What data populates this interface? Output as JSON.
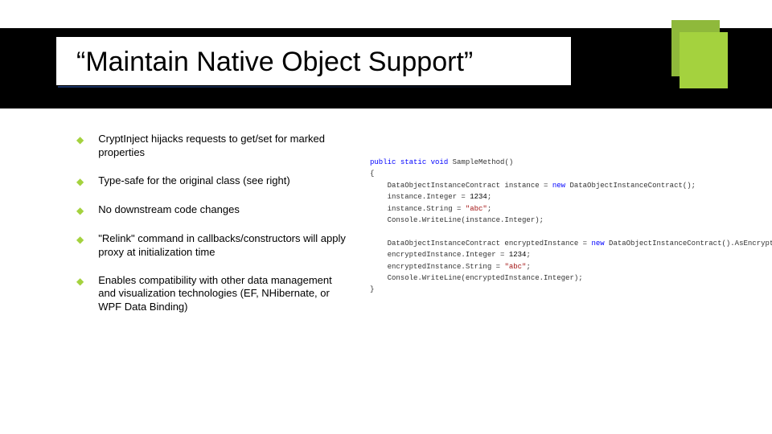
{
  "title": "“Maintain Native Object Support”",
  "bullets": [
    "CryptInject hijacks requests to get/set for marked properties",
    "Type-safe for the original class (see right)",
    "No downstream code changes",
    "\"Relink\" command in callbacks/constructors will apply proxy at initialization time",
    "Enables compatibility with other data management and visualization technologies (EF, NHibernate, or WPF Data Binding)"
  ],
  "code": {
    "l1a": "public",
    "l1b": "static",
    "l1c": "void",
    "l1d": " SampleMethod()",
    "l2": "{",
    "l3a": "    DataObjectInstanceContract instance = ",
    "l3b": "new",
    "l3c": " DataObjectInstanceContract();",
    "l4a": "    instance.Integer = ",
    "l4b": "1234",
    "l4c": ";",
    "l5a": "    instance.String = ",
    "l5b": "\"abc\"",
    "l5c": ";",
    "l6a": "    Console.WriteLine(instance.Integer);",
    "l7a": "    DataObjectInstanceContract encryptedInstance = ",
    "l7b": "new",
    "l7c": " DataObjectInstanceContract().AsEncrypted();",
    "l8a": "    encryptedInstance.Integer = ",
    "l8b": "1234",
    "l8c": ";",
    "l9a": "    encryptedInstance.String = ",
    "l9b": "\"abc\"",
    "l9c": ";",
    "l10a": "    Console.WriteLine(encryptedInstance.Integer);",
    "l11": "}"
  }
}
